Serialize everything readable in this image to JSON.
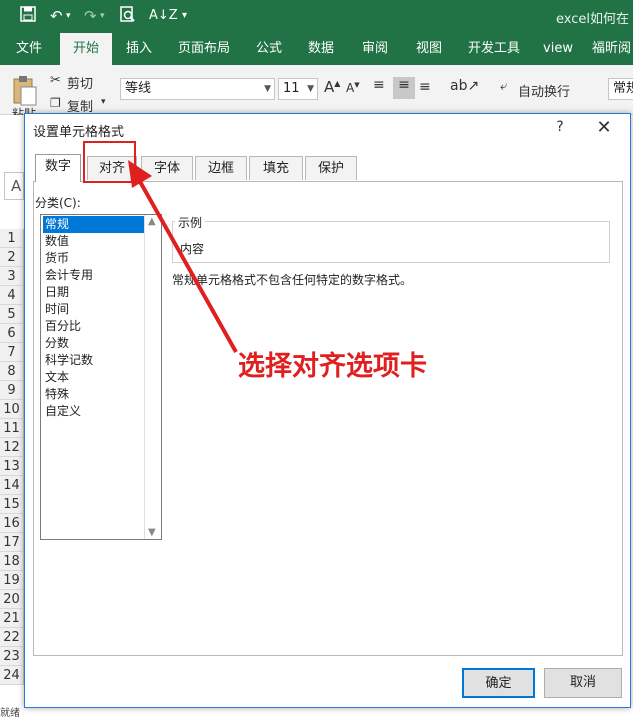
{
  "excel": {
    "window_title": "excel如何在",
    "quick_access": [
      "save-icon",
      "undo-icon",
      "redo-icon",
      "print-preview-icon",
      "sort-icon",
      "customize-icon"
    ],
    "ribbon_tabs": [
      "文件",
      "开始",
      "插入",
      "页面布局",
      "公式",
      "数据",
      "审阅",
      "视图",
      "开发工具",
      "view",
      "福昕阅"
    ],
    "active_tab": "开始",
    "clipboard": {
      "paste": "粘贴",
      "cut": "剪切",
      "copy": "复制"
    },
    "font": {
      "name": "等线",
      "size": "11",
      "grow": "A",
      "shrink": "A"
    },
    "wrap_text": "自动换行",
    "number_format": "常规",
    "name_box": "A",
    "row_numbers": [
      "1",
      "2",
      "3",
      "4",
      "5",
      "6",
      "7",
      "8",
      "9",
      "10",
      "11",
      "12",
      "13",
      "14",
      "15",
      "16",
      "17",
      "18",
      "19",
      "20",
      "21",
      "22",
      "23",
      "24"
    ],
    "sheet_tab": "就绪"
  },
  "dialog": {
    "title": "设置单元格格式",
    "help": "?",
    "close": "✕",
    "tabs": [
      "数字",
      "对齐",
      "字体",
      "边框",
      "填充",
      "保护"
    ],
    "active_tab": "数字",
    "category_label": "分类(C):",
    "categories": [
      "常规",
      "数值",
      "货币",
      "会计专用",
      "日期",
      "时间",
      "百分比",
      "分数",
      "科学记数",
      "文本",
      "特殊",
      "自定义"
    ],
    "selected_category": "常规",
    "sample_label": "示例",
    "sample_value": "内容",
    "description": "常规单元格格式不包含任何特定的数字格式。",
    "ok": "确定",
    "cancel": "取消"
  },
  "annotation": {
    "text": "选择对齐选项卡",
    "color": "#e02020"
  },
  "colors": {
    "excel_green": "#217346",
    "selection_blue": "#0078d7"
  }
}
